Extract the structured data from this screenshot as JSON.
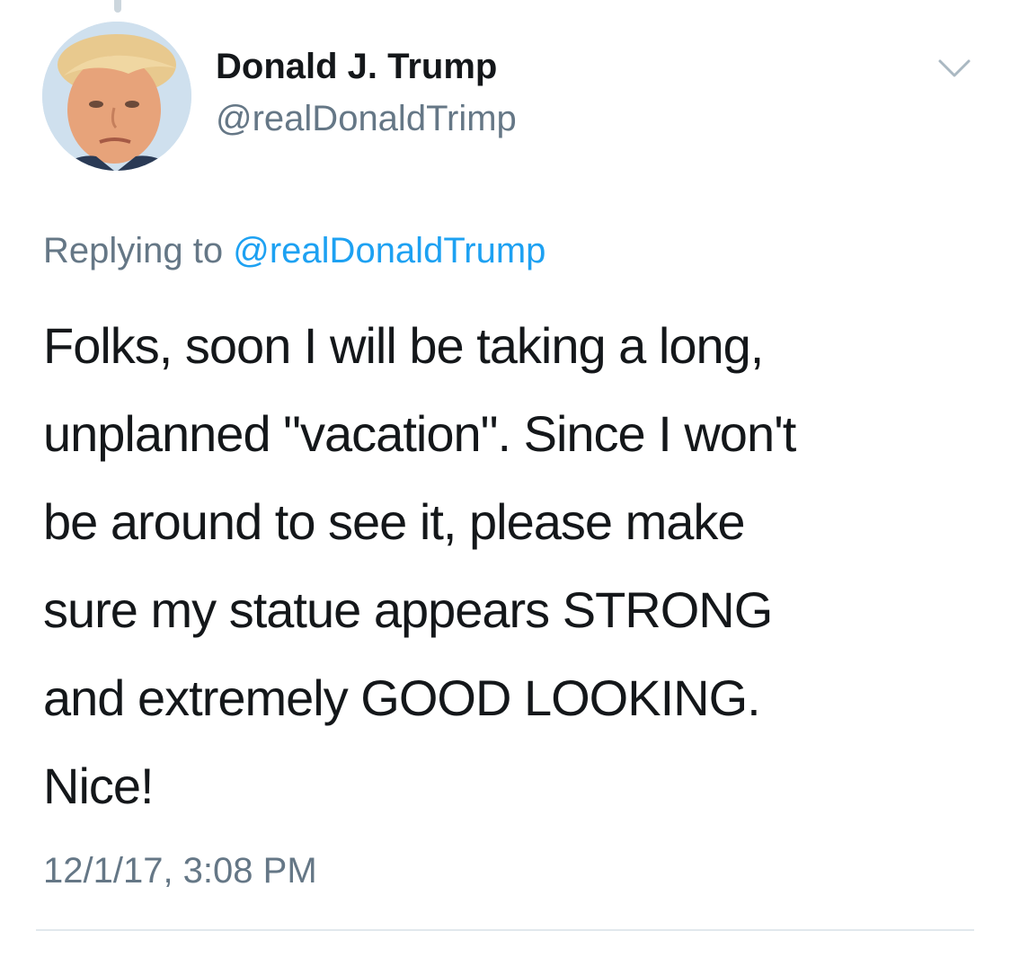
{
  "tweet": {
    "author": {
      "display_name": "Donald J. Trump",
      "handle": "@realDonaldTrimp",
      "avatar_icon": "profile-photo"
    },
    "reply": {
      "prefix": "Replying to",
      "mention": "@realDonaldTrump"
    },
    "text_lines": [
      "Folks, soon I will be taking a long,",
      "unplanned \"vacation\". Since I won't",
      "be around to see it, please make",
      "sure my statue appears STRONG",
      "and extremely GOOD LOOKING.",
      "Nice!"
    ],
    "timestamp": "12/1/17, 3:08 PM"
  },
  "colors": {
    "text_primary": "#14171a",
    "text_secondary": "#657786",
    "link": "#1da1f2",
    "divider": "#e1e8ed"
  },
  "icons": {
    "menu": "chevron-down-icon"
  }
}
